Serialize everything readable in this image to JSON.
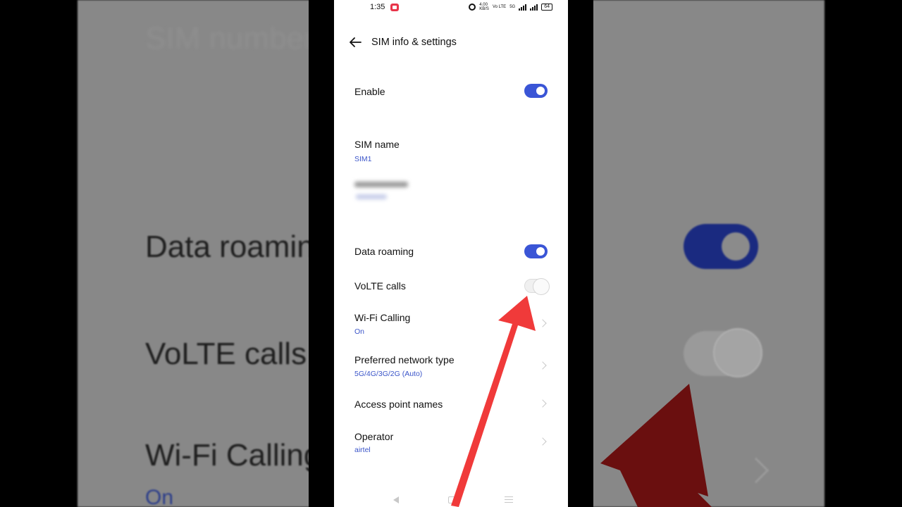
{
  "status": {
    "time": "1:35",
    "speed_value": "4.00",
    "speed_unit": "KB/S",
    "network_label": "Vo LTE",
    "network_type": "5G",
    "battery": "64"
  },
  "header": {
    "title": "SIM info & settings"
  },
  "settings": {
    "enable": {
      "label": "Enable",
      "state": "on"
    },
    "sim_name": {
      "label": "SIM name",
      "value": "SIM1"
    },
    "data_roaming": {
      "label": "Data roaming",
      "state": "on"
    },
    "volte": {
      "label": "VoLTE calls",
      "state": "off"
    },
    "wifi_calling": {
      "label": "Wi-Fi Calling",
      "value": "On"
    },
    "network_type": {
      "label": "Preferred network type",
      "value": "5G/4G/3G/2G (Auto)"
    },
    "apn": {
      "label": "Access point names"
    },
    "operator": {
      "label": "Operator",
      "value": "airtel"
    }
  },
  "background": {
    "text_1": "SIM number",
    "text_2": "Data roaming",
    "text_3": "VoLTE calls",
    "text_4": "Wi-Fi Calling",
    "text_5": "On"
  },
  "colors": {
    "accent": "#3a55d6",
    "subtext": "#3b55c9",
    "annotation_arrow": "#f03a3a"
  },
  "icons": [
    "back-arrow-icon",
    "alarm-icon",
    "signal-icon",
    "battery-icon",
    "chevron-right-icon",
    "nav-back-icon",
    "nav-home-icon",
    "nav-menu-icon",
    "annotation-arrow-icon"
  ]
}
